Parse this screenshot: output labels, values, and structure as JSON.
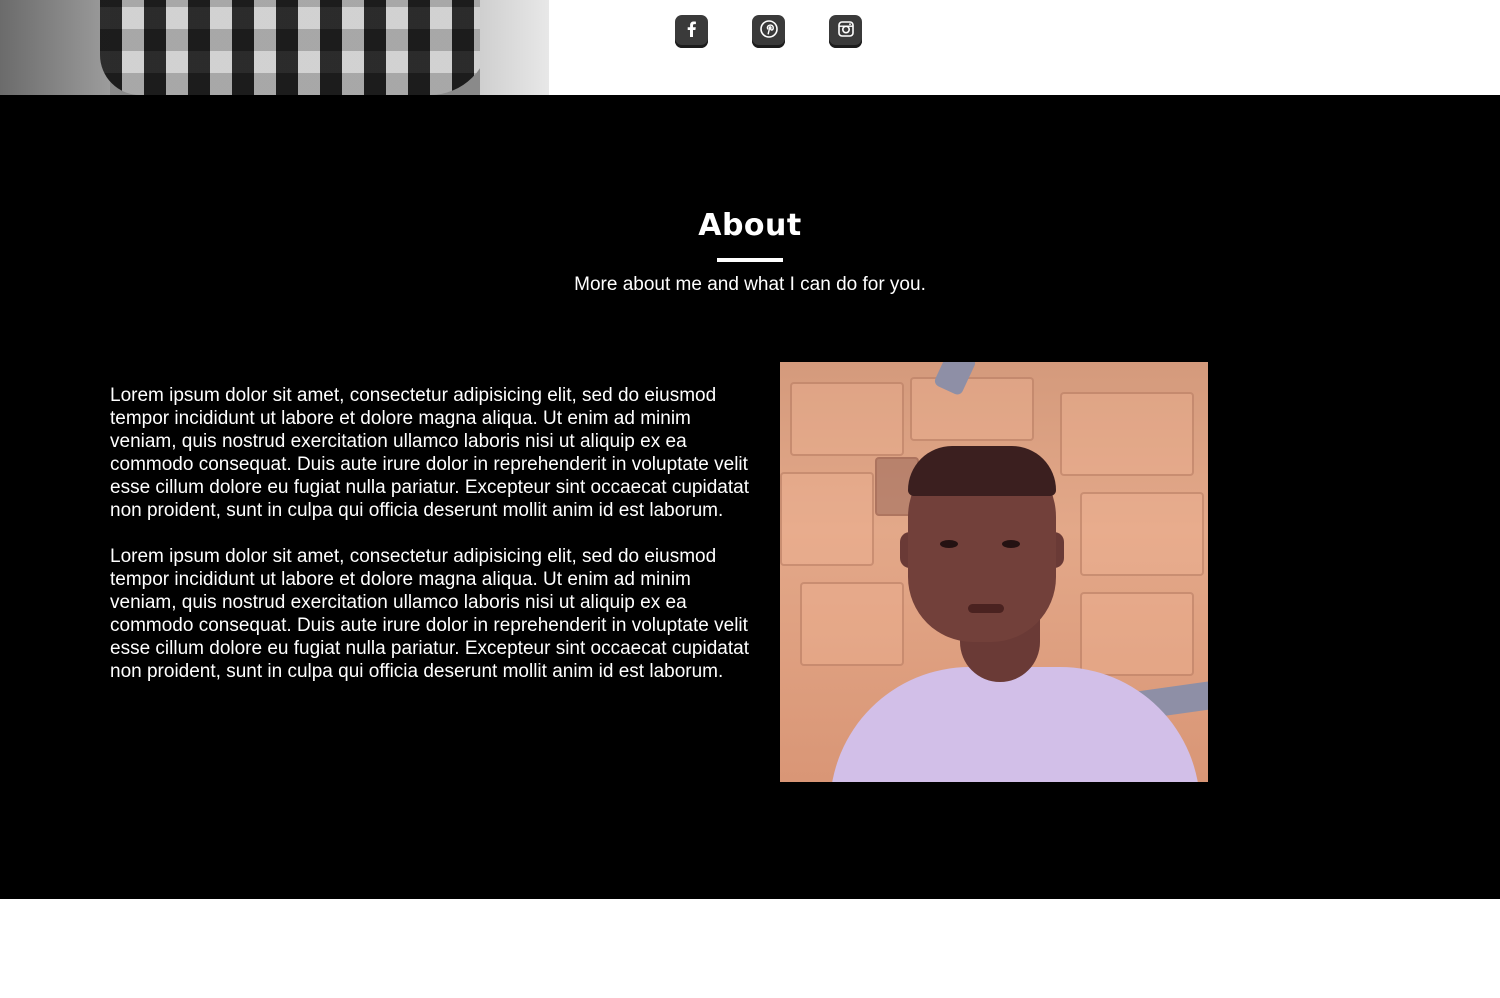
{
  "header": {
    "social": [
      {
        "name": "facebook",
        "icon": "facebook-icon"
      },
      {
        "name": "pinterest",
        "icon": "pinterest-icon"
      },
      {
        "name": "instagram",
        "icon": "instagram-icon"
      }
    ]
  },
  "about": {
    "title": "About",
    "subtitle": "More about me and what I can do for you.",
    "paragraphs": [
      "Lorem ipsum dolor sit amet, consectetur adipisicing elit, sed do eiusmod tempor incididunt ut labore et dolore magna aliqua. Ut enim ad minim veniam, quis nostrud exercitation ullamco laboris nisi ut aliquip ex ea commodo consequat. Duis aute irure dolor in reprehenderit in voluptate velit esse cillum dolore eu fugiat nulla pariatur. Excepteur sint occaecat cupidatat non proident, sunt in culpa qui officia deserunt mollit anim id est laborum.",
      "Lorem ipsum dolor sit amet, consectetur adipisicing elit, sed do eiusmod tempor incididunt ut labore et dolore magna aliqua. Ut enim ad minim veniam, quis nostrud exercitation ullamco laboris nisi ut aliquip ex ea commodo consequat. Duis aute irure dolor in reprehenderit in voluptate velit esse cillum dolore eu fugiat nulla pariatur. Excepteur sint occaecat cupidatat non proident, sunt in culpa qui officia deserunt mollit anim id est laborum."
    ]
  },
  "colors": {
    "section_background": "#000000",
    "text": "#ffffff",
    "social_icon_bg": "#3a3a3a"
  }
}
